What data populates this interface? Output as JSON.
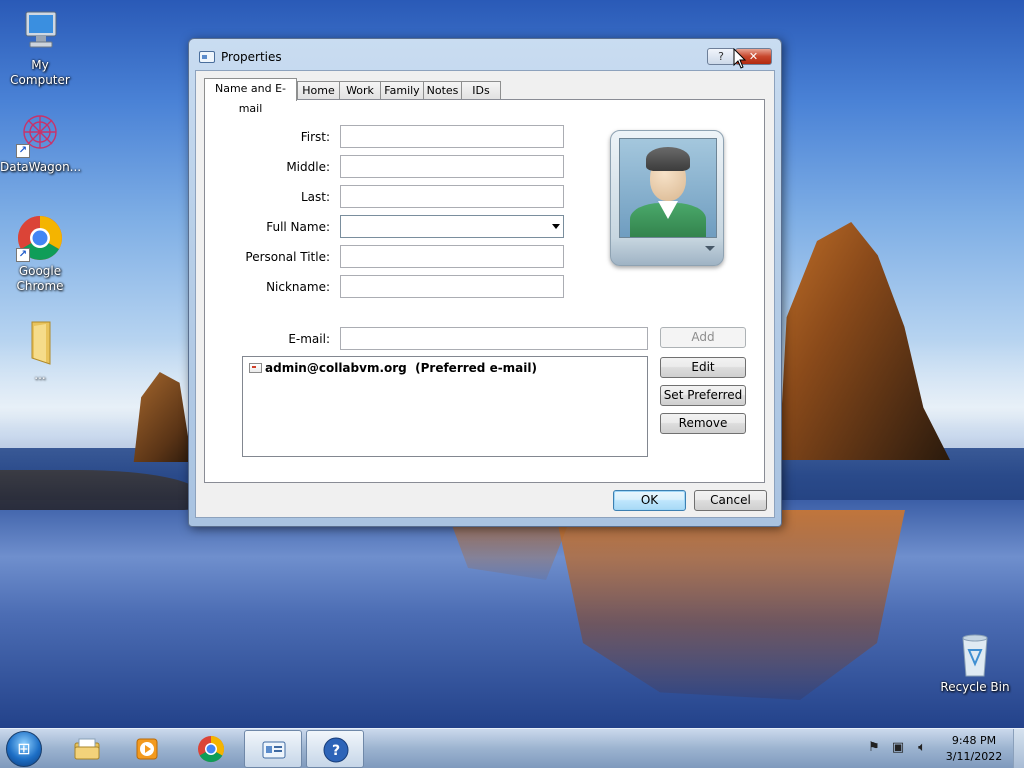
{
  "desktop": {
    "icons": [
      {
        "label": "My Computer"
      },
      {
        "label": "DataWagon..."
      },
      {
        "label": "Google Chrome"
      },
      {
        "label": "..."
      },
      {
        "label": "Recycle Bin"
      }
    ]
  },
  "dialog": {
    "title": "Properties",
    "help_label": "?",
    "close_label": "✕",
    "tabs": [
      {
        "label": "Name and E-mail",
        "active": true
      },
      {
        "label": "Home"
      },
      {
        "label": "Work"
      },
      {
        "label": "Family"
      },
      {
        "label": "Notes"
      },
      {
        "label": "IDs"
      }
    ],
    "fields": {
      "first": {
        "label": "First:",
        "value": ""
      },
      "middle": {
        "label": "Middle:",
        "value": ""
      },
      "last": {
        "label": "Last:",
        "value": ""
      },
      "full_name": {
        "label": "Full Name:",
        "value": ""
      },
      "personal_title": {
        "label": "Personal Title:",
        "value": ""
      },
      "nickname": {
        "label": "Nickname:",
        "value": ""
      },
      "email": {
        "label": "E-mail:",
        "value": ""
      }
    },
    "email_list": [
      {
        "address": "admin@collabvm.org",
        "note": "(Preferred e-mail)"
      }
    ],
    "buttons": {
      "add": "Add",
      "edit": "Edit",
      "set_preferred": "Set Preferred",
      "remove": "Remove",
      "ok": "OK",
      "cancel": "Cancel"
    }
  },
  "taskbar": {
    "clock_time": "9:48 PM",
    "clock_date": "3/11/2022"
  }
}
